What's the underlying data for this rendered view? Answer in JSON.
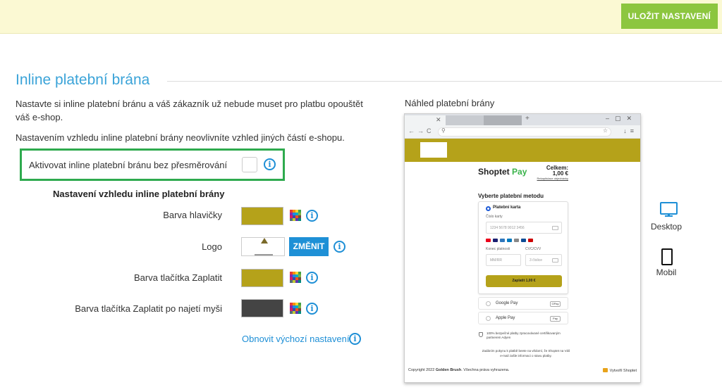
{
  "topbar": {
    "save_label": "ULOŽIT NASTAVENÍ"
  },
  "section": {
    "title": "Inline platební brána"
  },
  "intro": {
    "line1": "Nastavte si inline platební bránu a váš zákazník už nebude muset pro platbu opouštět váš e-shop.",
    "line2": "Nastavením vzhledu inline platební brány neovlivníte vzhled jiných částí e-shopu."
  },
  "activate": {
    "label": "Aktivovat inline platební bránu bez přesměrování",
    "checked": false
  },
  "appearance": {
    "heading": "Nastavení vzhledu inline platební brány",
    "rows": {
      "header_color": {
        "label": "Barva hlavičky",
        "color": "#b5a21a"
      },
      "logo": {
        "label": "Logo",
        "change_label": "ZMĚNIT"
      },
      "pay_color": {
        "label": "Barva tlačítka Zaplatit",
        "color": "#b5a21a"
      },
      "pay_hover_color": {
        "label": "Barva tlačítka Zaplatit po najetí myši",
        "color": "#444444"
      }
    },
    "reset_label": "Obnovit výchozí nastavení"
  },
  "preview": {
    "title": "Náhled platební brány",
    "header_color": "#b5a21a",
    "brand_part1": "Shoptet",
    "brand_part2": "Pay",
    "total_label": "Celkem:",
    "total_value": "1,00 €",
    "recap_link": "Rekapitulace objednávky",
    "choose_method": "Vyberte platební metodu",
    "card_label": "Platební karta",
    "card_number_label": "Číslo karty",
    "card_number_placeholder": "1234 5678 9012 3456",
    "expiry_label": "Konec platnosti",
    "expiry_placeholder": "MM/RR",
    "cvc_label": "CVC/CVV",
    "cvc_placeholder": "3 číslice",
    "pay_button": "Zaplatit 1,00 €",
    "google_pay": "Google Pay",
    "google_badge": "GPay",
    "apple_pay": "Apple Pay",
    "apple_badge": "Pay",
    "secure_text": "100% bezpečné platby zpracovávané certifikovaným partnerem Adyen",
    "notice_text": "Zadáním pokynu k platbě beete na vědomí, že Shoptet na Váš e-mail zašle informaci o stavu platby.",
    "copyright_pre": "Copyright 2022",
    "copyright_shop": "Golden Brush",
    "copyright_post": ". Všechna práva vyhrazena.",
    "made_by": "Vytvořil Shoptet"
  },
  "devices": {
    "desktop": "Desktop",
    "mobile": "Mobil"
  },
  "colors": {
    "accent_green": "#8cc63f",
    "accent_blue": "#1e8fd6",
    "highlight": "#2eaa4e"
  }
}
